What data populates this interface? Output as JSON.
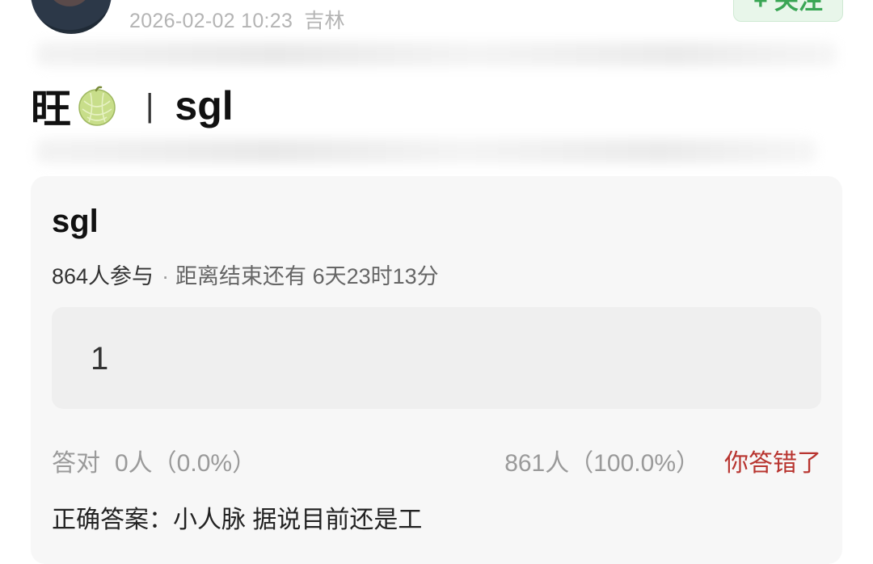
{
  "post": {
    "timestamp": "2026-02-02 10:23",
    "location": "吉林",
    "follow_label": "+ 关注",
    "title_prefix": "旺",
    "title_separator": "|",
    "title_suffix": "sgl",
    "emoji_icon": "melon-icon"
  },
  "quiz": {
    "title": "sgl",
    "participants": "864人参与",
    "separator": "·",
    "remaining": "距离结束还有 6天23时13分",
    "option": "1",
    "correct_label": "答对",
    "correct_count": "0人（0.0%）",
    "wrong_count": "861人（100.0%）",
    "wrong_status": "你答错了",
    "answer_label": "正确答案：",
    "answer_text": "小人脉 据说目前还是工"
  },
  "colors": {
    "accent_green": "#3aa655",
    "wrong_red": "#b8342f",
    "muted": "#9a9a9a"
  }
}
